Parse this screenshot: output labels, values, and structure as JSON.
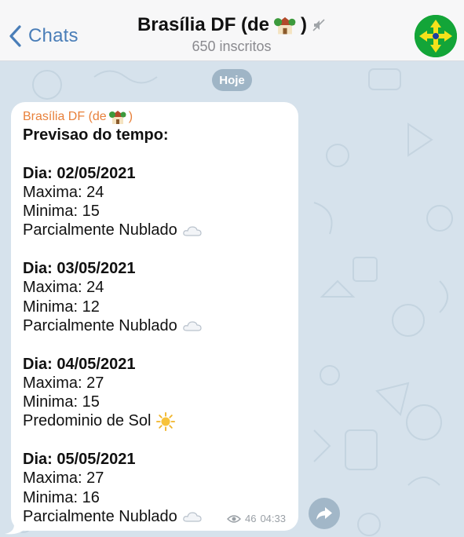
{
  "header": {
    "back_label": "Chats",
    "title": "Brasília DF (de",
    "title_close": ")",
    "subtitle": "650 inscritos"
  },
  "chat": {
    "date_label": "Hoje",
    "message": {
      "sender": "Brasília DF (de",
      "sender_close": ")",
      "heading": "Previsao do tempo:",
      "days": [
        {
          "date": "Dia: 02/05/2021",
          "max": "Maxima: 24",
          "min": "Minima: 15",
          "condition": "Parcialmente Nublado",
          "icon": "cloud-icon"
        },
        {
          "date": "Dia: 03/05/2021",
          "max": "Maxima: 24",
          "min": "Minima: 12",
          "condition": "Parcialmente Nublado",
          "icon": "cloud-icon"
        },
        {
          "date": "Dia: 04/05/2021",
          "max": "Maxima: 27",
          "min": "Minima: 15",
          "condition": "Predominio de Sol",
          "icon": "sun-icon"
        },
        {
          "date": "Dia: 05/05/2021",
          "max": "Maxima: 27",
          "min": "Minima: 16",
          "condition": "Parcialmente Nublado",
          "icon": "cloud-icon"
        }
      ],
      "views": "46",
      "time": "04:33"
    }
  },
  "colors": {
    "accent": "#4a7eb8",
    "sender": "#e8813b",
    "background": "#d6e2ec"
  }
}
